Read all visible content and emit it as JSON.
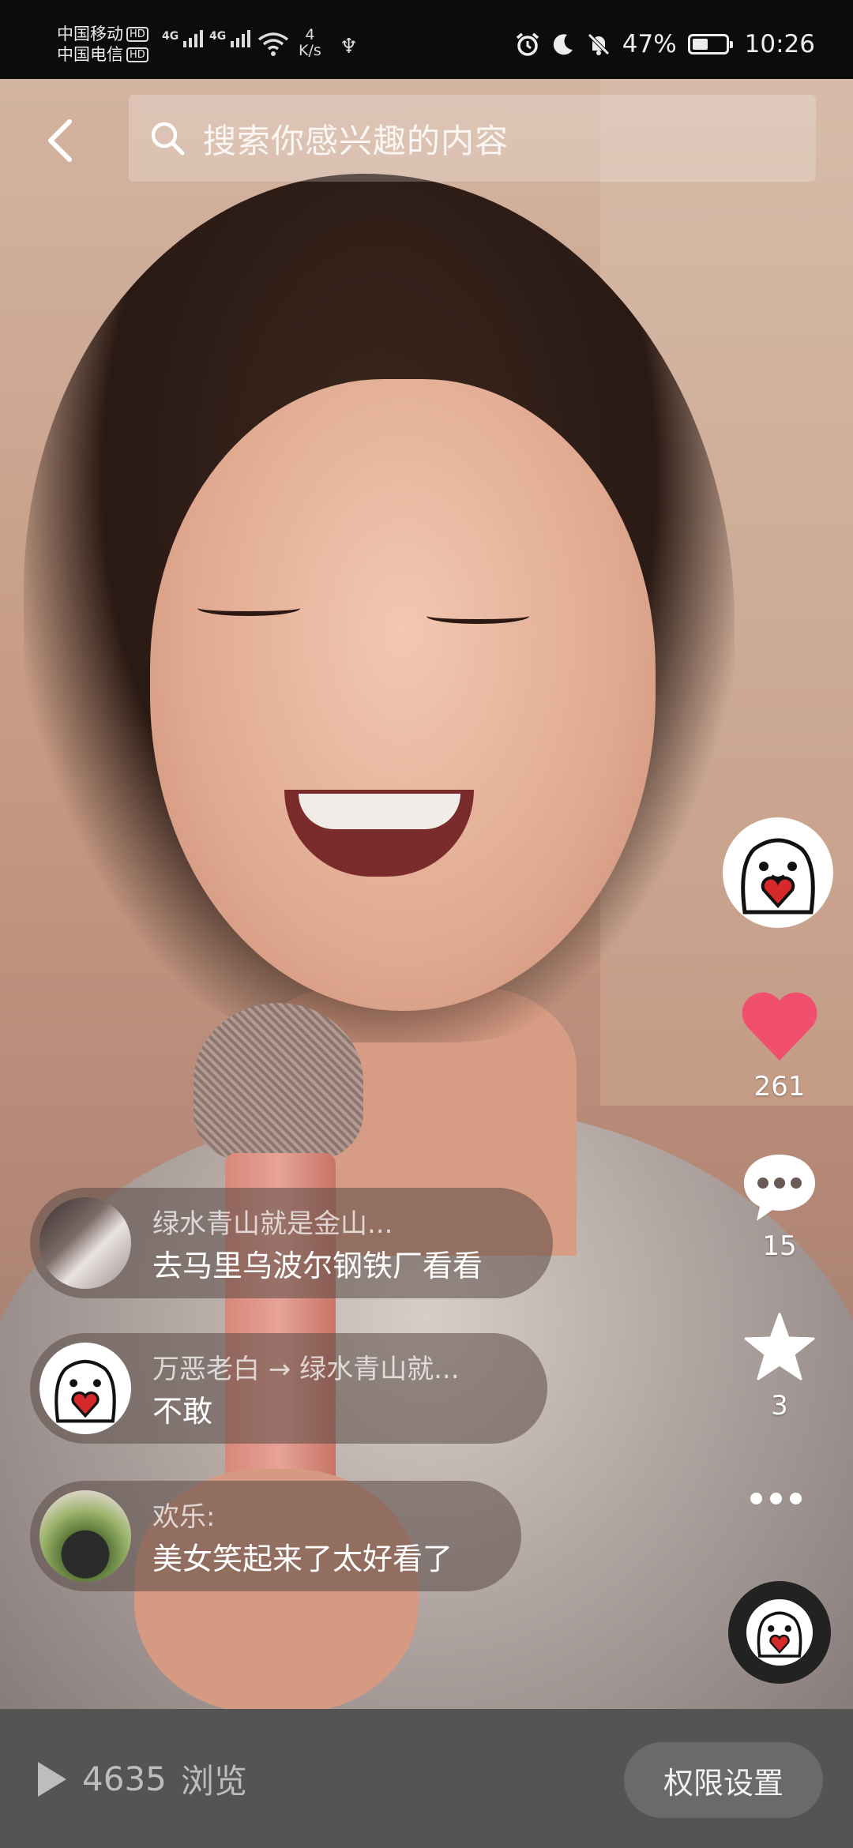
{
  "status_bar": {
    "carrier_1": "中国移动",
    "carrier_2": "中国电信",
    "hd_badge": "HD",
    "network_type": "4G",
    "speed_value": "4",
    "speed_unit": "K/s",
    "battery_percent": "47%",
    "battery_level": 0.47,
    "time": "10:26"
  },
  "search": {
    "placeholder": "搜索你感兴趣的内容"
  },
  "right_rail": {
    "like_count": "261",
    "comment_count": "15",
    "favorite_count": "3"
  },
  "comments": [
    {
      "name": "绿水青山就是金山...",
      "text": "去马里乌波尔钢铁厂看看"
    },
    {
      "name": "万恶老白 → 绿水青山就...",
      "text": "不敢"
    },
    {
      "name": "欢乐:",
      "text": "美女笑起来了太好看了"
    }
  ],
  "bottom_bar": {
    "view_count": "4635",
    "view_label": "浏览",
    "permission_button": "权限设置"
  },
  "colors": {
    "like": "#f0506e",
    "bottom_bar": "#545454"
  }
}
